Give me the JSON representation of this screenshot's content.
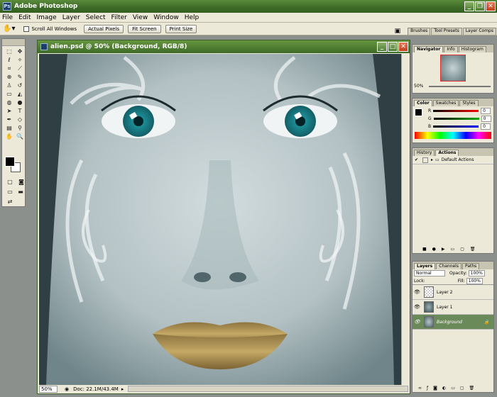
{
  "app": {
    "title": "Adobe Photoshop",
    "logo": "Ps"
  },
  "menu": [
    "File",
    "Edit",
    "Image",
    "Layer",
    "Select",
    "Filter",
    "View",
    "Window",
    "Help"
  ],
  "options": {
    "scroll_all": "Scroll All Windows",
    "actual": "Actual Pixels",
    "fit": "Fit Screen",
    "print": "Print Size"
  },
  "well_tabs": [
    "Brushes",
    "Tool Presets",
    "Layer Comps"
  ],
  "document": {
    "title": "alien.psd @ 50% (Background, RGB/8)",
    "zoom": "50%",
    "doc_info": "Doc: 22.1M/43.4M"
  },
  "navigator": {
    "tabs": [
      "Navigator",
      "Info",
      "Histogram"
    ],
    "zoom": "50%"
  },
  "color": {
    "tabs": [
      "Color",
      "Swatches",
      "Styles"
    ],
    "r": "0",
    "g": "0",
    "b": "0",
    "labels": [
      "R",
      "G",
      "B"
    ]
  },
  "actions": {
    "tabs": [
      "History",
      "Actions"
    ],
    "item": "Default Actions"
  },
  "layers": {
    "tabs": [
      "Layers",
      "Channels",
      "Paths"
    ],
    "mode": "Normal",
    "opacity_label": "Opacity:",
    "opacity": "100%",
    "lock_label": "Lock:",
    "fill_label": "Fill:",
    "fill": "100%",
    "items": [
      "Layer 2",
      "Layer 1",
      "Background"
    ]
  },
  "colors": {
    "title_green": "#3d6b28",
    "panel": "#ece9d8",
    "skin": "#c7d3d6",
    "eye": "#2a8f98",
    "lips": "#a88a48"
  }
}
